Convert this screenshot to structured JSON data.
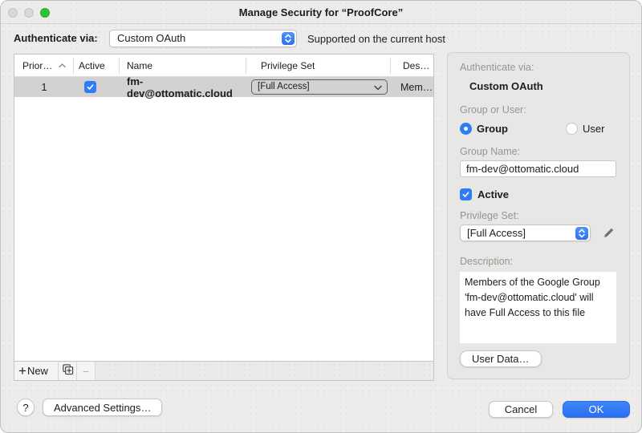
{
  "window": {
    "title": "Manage Security for “ProofCore”"
  },
  "authbar": {
    "label": "Authenticate via:",
    "value": "Custom OAuth",
    "note": "Supported on the current host"
  },
  "table": {
    "columns": [
      "Prior…",
      "Active",
      "Name",
      "Privilege Set",
      "Des…"
    ],
    "row": {
      "priority": "1",
      "active": true,
      "name": "fm-dev@ottomatic.cloud",
      "privilege_set": "[Full Access]",
      "description": "Mem…"
    }
  },
  "list_toolbar": {
    "new_label": "New",
    "minus": "−"
  },
  "detail_panel": {
    "authenticate_label": "Authenticate via:",
    "authenticate_value": "Custom OAuth",
    "group_or_user_label": "Group or User:",
    "group_radio": "Group",
    "user_radio": "User",
    "group_name_label": "Group Name:",
    "group_name_value": "fm-dev@ottomatic.cloud",
    "active_label": "Active",
    "privilege_set_label": "Privilege Set:",
    "privilege_set_value": "[Full Access]",
    "description_label": "Description:",
    "description_value": "Members of the Google Group 'fm-dev@ottomatic.cloud' will have Full Access to this file",
    "user_data_button": "User Data…"
  },
  "footer": {
    "help": "?",
    "advanced_button": "Advanced Settings…",
    "cancel_button": "Cancel",
    "ok_button": "OK"
  },
  "colors": {
    "accent_blue": "#2e7cf6",
    "selected_row": "#d3d2d0",
    "traffic_green": "#2fc33b",
    "panel_bg": "#e9e7e5"
  }
}
